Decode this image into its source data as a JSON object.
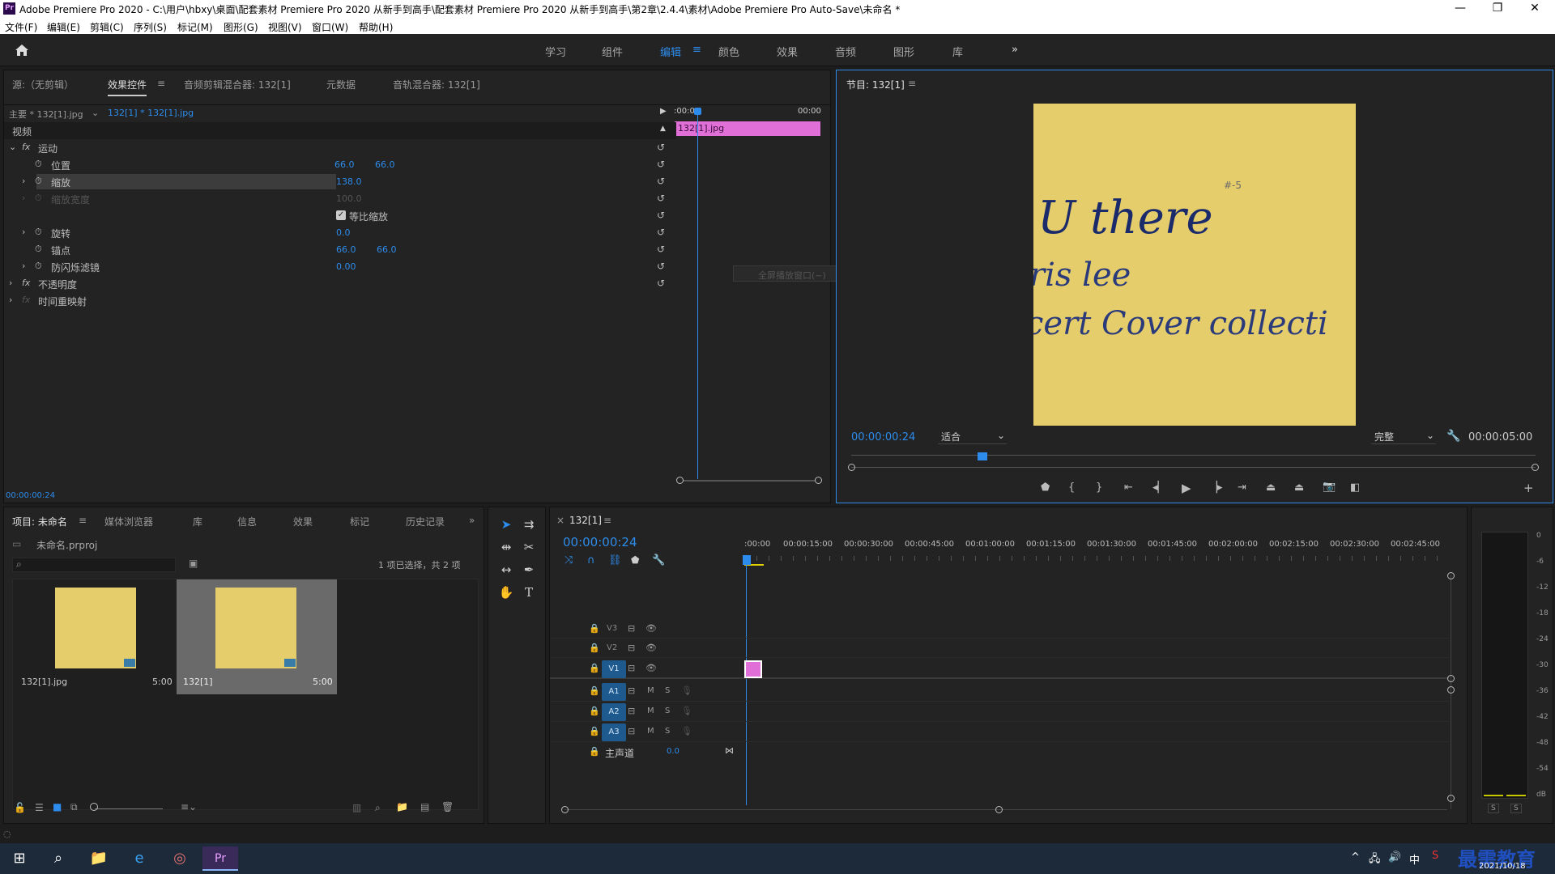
{
  "window": {
    "title": "Adobe Premiere Pro 2020 - C:\\用户\\hbxy\\桌面\\配套素材 Premiere Pro 2020 从新手到高手\\配套素材 Premiere Pro 2020 从新手到高手\\第2章\\2.4.4\\素材\\Adobe Premiere Pro Auto-Save\\未命名 *",
    "logo": "Pr",
    "minimize": "—",
    "maximize": "❐",
    "close": "✕"
  },
  "menu": [
    "文件(F)",
    "编辑(E)",
    "剪辑(C)",
    "序列(S)",
    "标记(M)",
    "图形(G)",
    "视图(V)",
    "窗口(W)",
    "帮助(H)"
  ],
  "workspaces": [
    "学习",
    "组件",
    "编辑",
    "颜色",
    "效果",
    "音频",
    "图形",
    "库"
  ],
  "workspace_active": "编辑",
  "workspace_more": "»",
  "top_tabs": {
    "source": "源:（无剪辑）",
    "effect_controls": "效果控件",
    "audio_clip_mixer": "音频剪辑混合器: 132[1]",
    "metadata": "元数据",
    "audio_track_mixer": "音轨混合器: 132[1]"
  },
  "ec": {
    "master": "主要 * 132[1].jpg",
    "seq": "132[1] * 132[1].jpg",
    "time_start": ":00:00",
    "time_end": "00:00",
    "clip_name": "132[1].jpg",
    "video_header": "视频",
    "motion": "运动",
    "position": {
      "label": "位置",
      "x": "66.0",
      "y": "66.0"
    },
    "scale": {
      "label": "缩放",
      "value": "138.0"
    },
    "scale_width": {
      "label": "缩放宽度",
      "value": "100.0"
    },
    "uniform": "等比缩放",
    "rotation": {
      "label": "旋转",
      "value": "0.0"
    },
    "anchor": {
      "label": "锚点",
      "x": "66.0",
      "y": "66.0"
    },
    "antiflicker": {
      "label": "防闪烁滤镜",
      "value": "0.00"
    },
    "opacity": "不透明度",
    "time_remap": "时间重映射",
    "tooltip": "全屏播放窗口(~)",
    "current_time": "00:00:00:24"
  },
  "program": {
    "title": "节目: 132[1]",
    "timecode": "00:00:00:24",
    "fit": "适合",
    "quality": "完整",
    "duration": "00:00:05:00",
    "image_text": {
      "line1": "U  there",
      "line2": "ris lee",
      "line3": "cert  Cover  collecti",
      "mark": "#-5"
    }
  },
  "project": {
    "tabs": [
      "项目: 未命名",
      "媒体浏览器",
      "库",
      "信息",
      "效果",
      "标记",
      "历史记录"
    ],
    "file": "未命名.prproj",
    "selection": "1 项已选择，共 2 项",
    "items": [
      {
        "name": "132[1].jpg",
        "duration": "5:00"
      },
      {
        "name": "132[1]",
        "duration": "5:00"
      }
    ]
  },
  "timeline": {
    "tab": "132[1]",
    "timecode": "00:00:00:24",
    "ruler": [
      ":00:00",
      "00:00:15:00",
      "00:00:30:00",
      "00:00:45:00",
      "00:01:00:00",
      "00:01:15:00",
      "00:01:30:00",
      "00:01:45:00",
      "00:02:00:00",
      "00:02:15:00",
      "00:02:30:00",
      "00:02:45:00"
    ],
    "video_tracks": [
      "V3",
      "V2",
      "V1"
    ],
    "audio_tracks": [
      "A1",
      "A2",
      "A3"
    ],
    "mute": "M",
    "solo": "S",
    "master": {
      "label": "主声道",
      "value": "0.0"
    }
  },
  "meter": {
    "scale": [
      "0",
      "-6",
      "-12",
      "-18",
      "-24",
      "-30",
      "-36",
      "-42",
      "-48",
      "-54",
      "dB"
    ],
    "solo": [
      "S",
      "S"
    ]
  },
  "taskbar": {
    "date": "2021/10/18",
    "watermark": "最需教育",
    "ime": "中"
  }
}
